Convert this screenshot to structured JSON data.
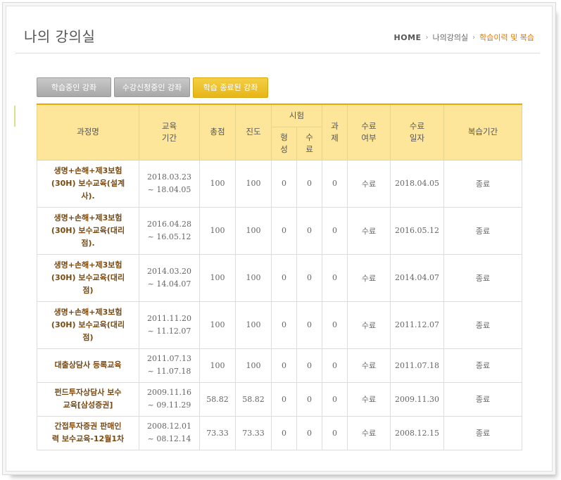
{
  "page": {
    "title": "나의 강의실"
  },
  "breadcrumb": {
    "home": "HOME",
    "sep1": "›",
    "item1": "나의강의실",
    "sep2": "›",
    "current": "학습이력 및 복습"
  },
  "tabs": [
    {
      "label": "학습중인 강좌"
    },
    {
      "label": "수강신청중인 강좌"
    },
    {
      "label": "학습 종료된 강좌"
    }
  ],
  "table": {
    "headers": {
      "course": "과정명",
      "period_a": "교육",
      "period_b": "기간",
      "total": "총점",
      "progress": "진도",
      "exam": "시험",
      "exam_form_a": "형",
      "exam_form_b": "성",
      "exam_final_a": "수",
      "exam_final_b": "료",
      "task_a": "과",
      "task_b": "제",
      "complete_a": "수료",
      "complete_b": "여부",
      "date_a": "수료",
      "date_b": "일자",
      "review": "복습기간"
    },
    "rows": [
      {
        "course": [
          "생명+손해+제3보험",
          "(30H) 보수교육(설계",
          "사)."
        ],
        "start": "2018.03.23",
        "end": "~ 18.04.05",
        "total": "100",
        "progress": "100",
        "form": "0",
        "final": "0",
        "task": "0",
        "complete": "수료",
        "date": "2018.04.05",
        "review": "종료"
      },
      {
        "course": [
          "생명+손해+제3보험",
          "(30H) 보수교육(대리",
          "점)."
        ],
        "start": "2016.04.28",
        "end": "~ 16.05.12",
        "total": "100",
        "progress": "100",
        "form": "0",
        "final": "0",
        "task": "0",
        "complete": "수료",
        "date": "2016.05.12",
        "review": "종료"
      },
      {
        "course": [
          "생명+손해+제3보험",
          "(30H) 보수교육(대리",
          "점)"
        ],
        "start": "2014.03.20",
        "end": "~ 14.04.07",
        "total": "100",
        "progress": "100",
        "form": "0",
        "final": "0",
        "task": "0",
        "complete": "수료",
        "date": "2014.04.07",
        "review": "종료"
      },
      {
        "course": [
          "생명+손해+제3보험",
          "(30H) 보수교육(대리",
          "점)"
        ],
        "start": "2011.11.20",
        "end": "~ 11.12.07",
        "total": "100",
        "progress": "100",
        "form": "0",
        "final": "0",
        "task": "0",
        "complete": "수료",
        "date": "2011.12.07",
        "review": "종료"
      },
      {
        "course": [
          "대출상담사 등록교육"
        ],
        "start": "2011.07.13",
        "end": "~ 11.07.18",
        "total": "100",
        "progress": "100",
        "form": "0",
        "final": "0",
        "task": "0",
        "complete": "수료",
        "date": "2011.07.18",
        "review": "종료"
      },
      {
        "course": [
          "펀드투자상담사 보수",
          "교육[삼성증권]"
        ],
        "start": "2009.11.16",
        "end": "~ 09.11.29",
        "total": "58.82",
        "progress": "58.82",
        "form": "0",
        "final": "0",
        "task": "0",
        "complete": "수료",
        "date": "2009.11.30",
        "review": "종료"
      },
      {
        "course": [
          "간접투자증권 판매인",
          "력 보수교육-12월1차"
        ],
        "start": "2008.12.01",
        "end": "~ 08.12.14",
        "total": "73.33",
        "progress": "73.33",
        "form": "0",
        "final": "0",
        "task": "0",
        "complete": "수료",
        "date": "2008.12.15",
        "review": "종료"
      }
    ]
  }
}
